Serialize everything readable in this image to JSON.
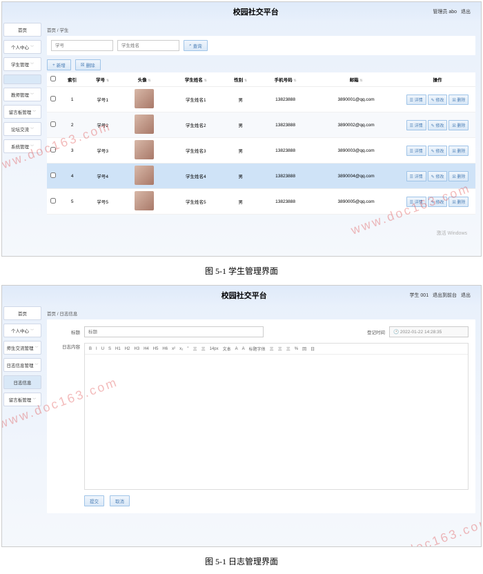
{
  "app_title": "校园社交平台",
  "screenshot1": {
    "header_user": "管理员 abo",
    "header_logout": "退出",
    "breadcrumb": "首页 / 学生",
    "sidebar": [
      "首页",
      "个人中心",
      "学生管理",
      "",
      "教师管理",
      "留言板管理",
      "论坛交流",
      "系统管理"
    ],
    "search1_placeholder": "学号",
    "search2_placeholder": "学生姓名",
    "btn_search": "查询",
    "btn_add": "新增",
    "btn_del": "删除",
    "columns": {
      "idx": "索引",
      "sid": "学号",
      "avatar": "头像",
      "name": "学生姓名",
      "gender": "性别",
      "phone": "手机号码",
      "email": "邮箱",
      "ops": "操作"
    },
    "rows": [
      {
        "idx": "1",
        "sid": "学号1",
        "name": "学生姓名1",
        "gender": "男",
        "phone": "13823888",
        "email": "3890001@qq.com"
      },
      {
        "idx": "2",
        "sid": "学号2",
        "name": "学生姓名2",
        "gender": "男",
        "phone": "13823888",
        "email": "3890002@qq.com"
      },
      {
        "idx": "3",
        "sid": "学号3",
        "name": "学生姓名3",
        "gender": "男",
        "phone": "13823888",
        "email": "3890003@qq.com"
      },
      {
        "idx": "4",
        "sid": "学号4",
        "name": "学生姓名4",
        "gender": "男",
        "phone": "13823888",
        "email": "3890004@qq.com"
      },
      {
        "idx": "5",
        "sid": "学号5",
        "name": "学生姓名5",
        "gender": "男",
        "phone": "13823888",
        "email": "3890005@qq.com"
      }
    ],
    "op_detail": "详情",
    "op_edit": "修改",
    "op_del": "删除",
    "activate": "激活 Windows"
  },
  "caption1": "图 5-1  学生管理界面",
  "screenshot2": {
    "header_user": "学生 001",
    "header_back": "退出到前台",
    "header_logout": "退出",
    "breadcrumb": "首页 / 日志信息",
    "sidebar": [
      "首页",
      "个人中心",
      "师生交流管理",
      "日志信息管理",
      "日志信息",
      "留言板管理"
    ],
    "label_title": "标题",
    "title_placeholder": "标题",
    "label_date": "登记时间",
    "date_value": "2022-01-22 14:28:35",
    "label_content": "日志内容",
    "toolbar_items": [
      "B",
      "I",
      "U",
      "S",
      "H1",
      "H2",
      "H3",
      "H4",
      "H5",
      "H6",
      "x²",
      "x₂",
      "\"",
      "三",
      "三",
      "14px",
      "文本",
      "A",
      "A",
      "标题字体",
      "三",
      "三",
      "三",
      "%",
      "回",
      "日"
    ],
    "btn_submit": "提交",
    "btn_cancel": "取消"
  },
  "caption2": "图 5-1  日志管理界面",
  "watermark": "www.doc163.com"
}
